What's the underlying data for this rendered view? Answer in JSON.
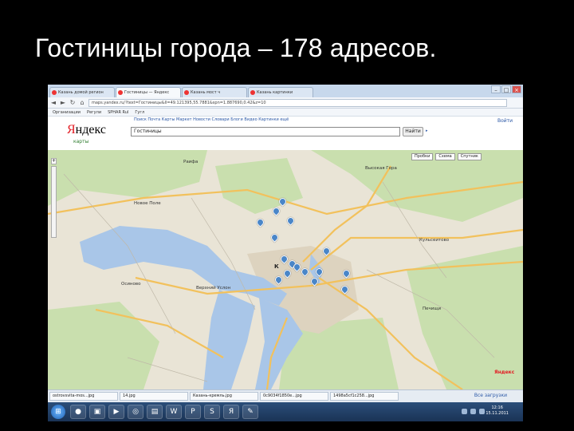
{
  "slide": {
    "title": "Гостиницы города – 178 адресов."
  },
  "browser": {
    "tabs": [
      {
        "label": "Казань домой регион"
      },
      {
        "label": "Гостиницы — Яндекс"
      },
      {
        "label": "Казань мост ч"
      },
      {
        "label": "Казань картинки"
      }
    ],
    "url": "maps.yandex.ru/?text=Гостиницы&ll=49.121395,55.7881&spn=1.887690,0.42&z=10",
    "bookmarks": [
      "Организации",
      "Регули",
      "SPHAR Rul",
      "Гугл"
    ]
  },
  "yandex": {
    "nav": "Поиск  Почта  Карты  Маркет  Новости  Словари  Блоги  Видео  Картинки  ещё",
    "logo": "Яндекс",
    "subtitle": "карты",
    "search_value": "Гостиницы",
    "find_button": "Найти",
    "enter_link": "Войти",
    "tools": [
      "Пробки",
      "Схема",
      "Спутник"
    ]
  },
  "map": {
    "labels": [
      {
        "text": "Высокая Гора"
      },
      {
        "text": "Новое Поле"
      },
      {
        "text": "Осиново"
      },
      {
        "text": "Верхний Услон"
      },
      {
        "text": "Кульсеитово"
      },
      {
        "text": "Раифа"
      },
      {
        "text": "Печищи"
      }
    ],
    "city_label": "К",
    "watermark": "Яндекс",
    "hotel_marker_count": 16
  },
  "downloads": {
    "items": [
      "ostrovsvita-mos...jpg",
      "14.jpg",
      "Казань-кремль.jpg",
      "0c9034f1850e...jpg",
      "1498a5cf1c258...jpg"
    ],
    "show_all": "Все загрузки"
  },
  "taskbar": {
    "clock_time": "12:16",
    "clock_date": "15.11.2011"
  },
  "colors": {
    "map_bg": "#e9e4d6",
    "water": "#a9c6e8",
    "forest": "#c9dfae",
    "road": "#f2c15c",
    "marker": "#4a86c8"
  }
}
